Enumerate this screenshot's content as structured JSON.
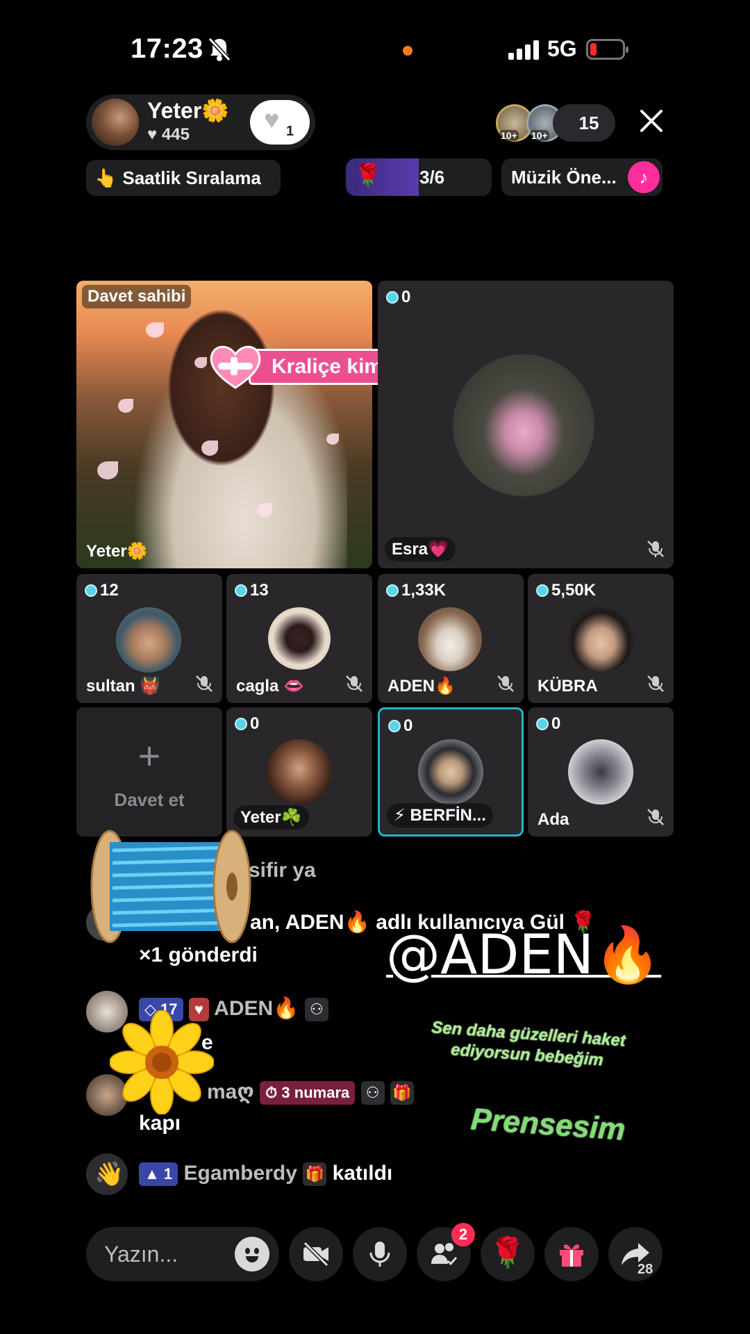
{
  "status_bar": {
    "time": "17:23",
    "network": "5G"
  },
  "host": {
    "name": "Yeter🌼",
    "likes": "♥ 445",
    "heart_count": "1"
  },
  "viewers": {
    "avatar_badges": [
      "10+",
      "10+"
    ],
    "count": "15"
  },
  "ranking_label": "Saatlik Sıralama",
  "rose_goal": {
    "progress": "3/6",
    "fraction": 0.5
  },
  "music_label": "Müzik Öne...",
  "host_tile": {
    "label": "Davet sahibi",
    "banner": "Kraliçe kim",
    "name": "Yeter🌼"
  },
  "guest_main": {
    "score": "0",
    "name": "Esra💗"
  },
  "guests": [
    {
      "score": "12",
      "name": "sultan 👹"
    },
    {
      "score": "13",
      "name": "cagla 👄"
    },
    {
      "score": "1,33K",
      "name": "ADEN🔥"
    },
    {
      "score": "5,50K",
      "name": "KÜBRA"
    },
    {
      "score": "0",
      "name": "Yeter☘️"
    },
    {
      "score": "0",
      "name": "⚡ BERFİN..."
    },
    {
      "score": "0",
      "name": "Ada"
    }
  ],
  "invite": {
    "plus": "+",
    "label": "Davet et"
  },
  "chat": {
    "line1": "sifir ya",
    "line2a": "an, ADEN🔥 adlı kullanıcıya Gül 🌹",
    "line2b": "×1 gönderdi",
    "msg3_badge_level": "17",
    "msg3_user": "ADEN🔥",
    "msg3_text": "e",
    "msg4_user": "ma",
    "msg4_badge": "3 numara",
    "msg4_text": "kapı",
    "join_badge": "1",
    "join_user": "Egamberdy",
    "join_text": "katıldı"
  },
  "overlay": {
    "mention": "@ADEN🔥",
    "green_small": "Sen daha güzelleri haket ediyorsun bebeğim",
    "green_big": "Prensesim"
  },
  "bottom_bar": {
    "placeholder": "Yazın...",
    "notification_count": "2",
    "share_count": "28"
  },
  "colors": {
    "accent_pink": "#ec4f8f",
    "active_border": "#27b3c9",
    "notification": "#ff2d55"
  }
}
